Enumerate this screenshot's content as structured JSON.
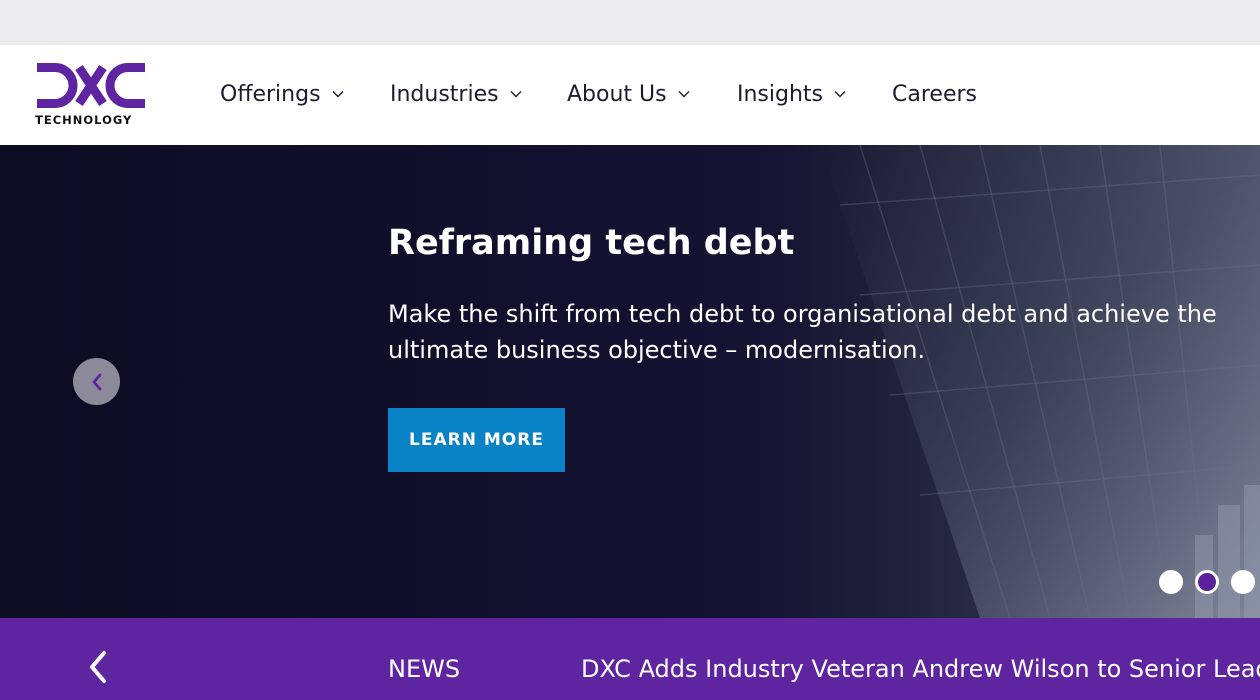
{
  "logo": {
    "sub": "TECHNOLOGY",
    "brand_color": "#5f249f"
  },
  "nav": {
    "items": [
      {
        "label": "Offerings",
        "has_dropdown": true
      },
      {
        "label": "Industries",
        "has_dropdown": true
      },
      {
        "label": "About Us",
        "has_dropdown": true
      },
      {
        "label": "Insights",
        "has_dropdown": true
      },
      {
        "label": "Careers",
        "has_dropdown": false
      }
    ]
  },
  "hero": {
    "title": "Reframing tech debt",
    "text": "Make the shift from tech debt to organisational debt and achieve the ultimate business objective – modernisation.",
    "cta_label": "LEARN MORE",
    "cta_color": "#0a83c6",
    "slides_total": 3,
    "active_slide": 2
  },
  "news": {
    "label": "NEWS",
    "headline": "DXC Adds Industry Veteran Andrew Wilson to Senior Leadership",
    "bg_color": "#5f249f"
  },
  "icons": {
    "prev": "chevron-left-icon",
    "dropdown": "chevron-down-icon"
  }
}
